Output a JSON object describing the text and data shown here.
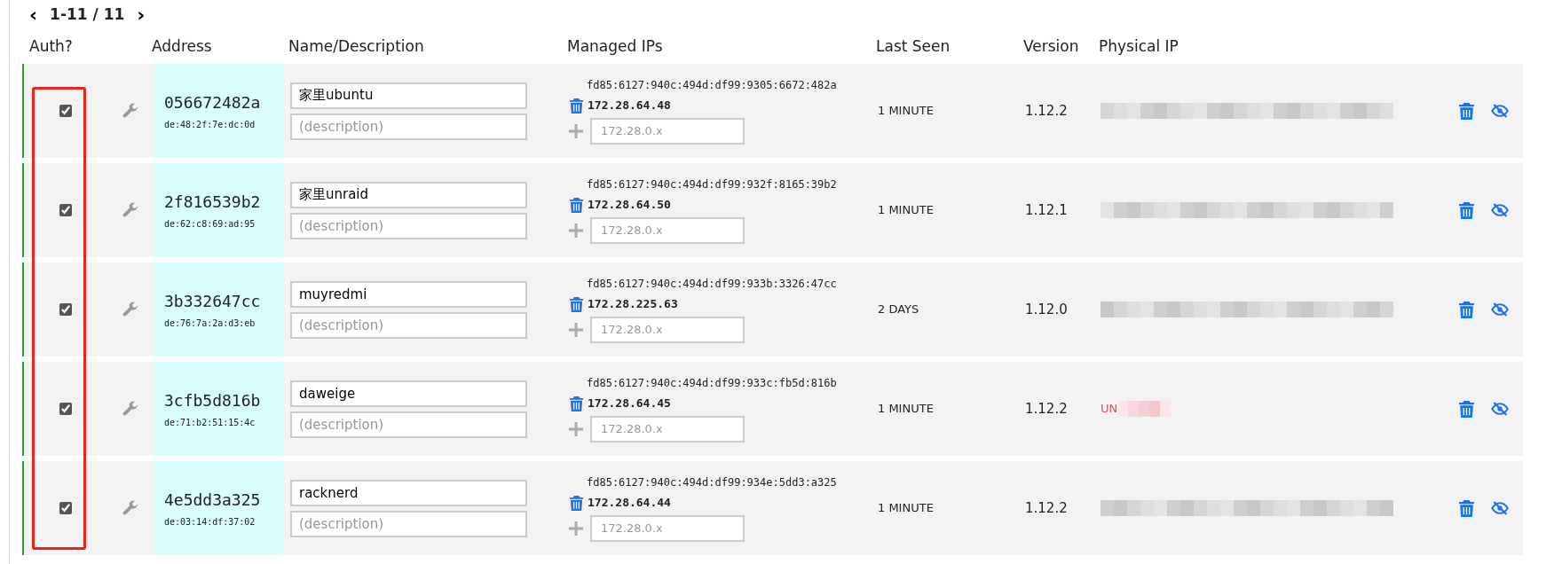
{
  "pager": {
    "prev": "‹",
    "range": "1-11 / 11",
    "next": "›"
  },
  "columns": [
    "Auth?",
    "",
    "Address",
    "Name/Description",
    "Managed IPs",
    "Last Seen",
    "Version",
    "Physical IP"
  ],
  "auth_highlight": true,
  "rows": [
    {
      "authorized": true,
      "address": "056672482a",
      "mac": "de:48:2f:7e:dc:0d",
      "name": "家里ubuntu",
      "description_placeholder": "(description)",
      "ipv6": "fd85:6127:940c:494d:df99:9305:6672:482a",
      "ipv4": "172.28.64.48",
      "add_placeholder": "172.28.0.x",
      "last_seen": "1 MINUTE",
      "version": "1.12.2"
    },
    {
      "authorized": true,
      "address": "2f816539b2",
      "mac": "de:62:c8:69:ad:95",
      "name": "家里unraid",
      "description_placeholder": "(description)",
      "ipv6": "fd85:6127:940c:494d:df99:932f:8165:39b2",
      "ipv4": "172.28.64.50",
      "add_placeholder": "172.28.0.x",
      "last_seen": "1 MINUTE",
      "version": "1.12.1"
    },
    {
      "authorized": true,
      "address": "3b332647cc",
      "mac": "de:76:7a:2a:d3:eb",
      "name": "muyredmi",
      "description_placeholder": "(description)",
      "ipv6": "fd85:6127:940c:494d:df99:933b:3326:47cc",
      "ipv4": "172.28.225.63",
      "add_placeholder": "172.28.0.x",
      "last_seen": "2 DAYS",
      "version": "1.12.0"
    },
    {
      "authorized": true,
      "address": "3cfb5d816b",
      "mac": "de:71:b2:51:15:4c",
      "name": "daweige",
      "description_placeholder": "(description)",
      "ipv6": "fd85:6127:940c:494d:df99:933c:fb5d:816b",
      "ipv4": "172.28.64.45",
      "add_placeholder": "172.28.0.x",
      "last_seen": "1 MINUTE",
      "version": "1.12.2",
      "physical_ip": {
        "text": "UN",
        "alert": true
      }
    },
    {
      "authorized": true,
      "address": "4e5dd3a325",
      "mac": "de:03:14:df:37:02",
      "name": "racknerd",
      "description_placeholder": "(description)",
      "ipv6": "fd85:6127:940c:494d:df99:934e:5dd3:a325",
      "ipv4": "172.28.64.44",
      "add_placeholder": "172.28.0.x",
      "last_seen": "1 MINUTE",
      "version": "1.12.2"
    }
  ]
}
